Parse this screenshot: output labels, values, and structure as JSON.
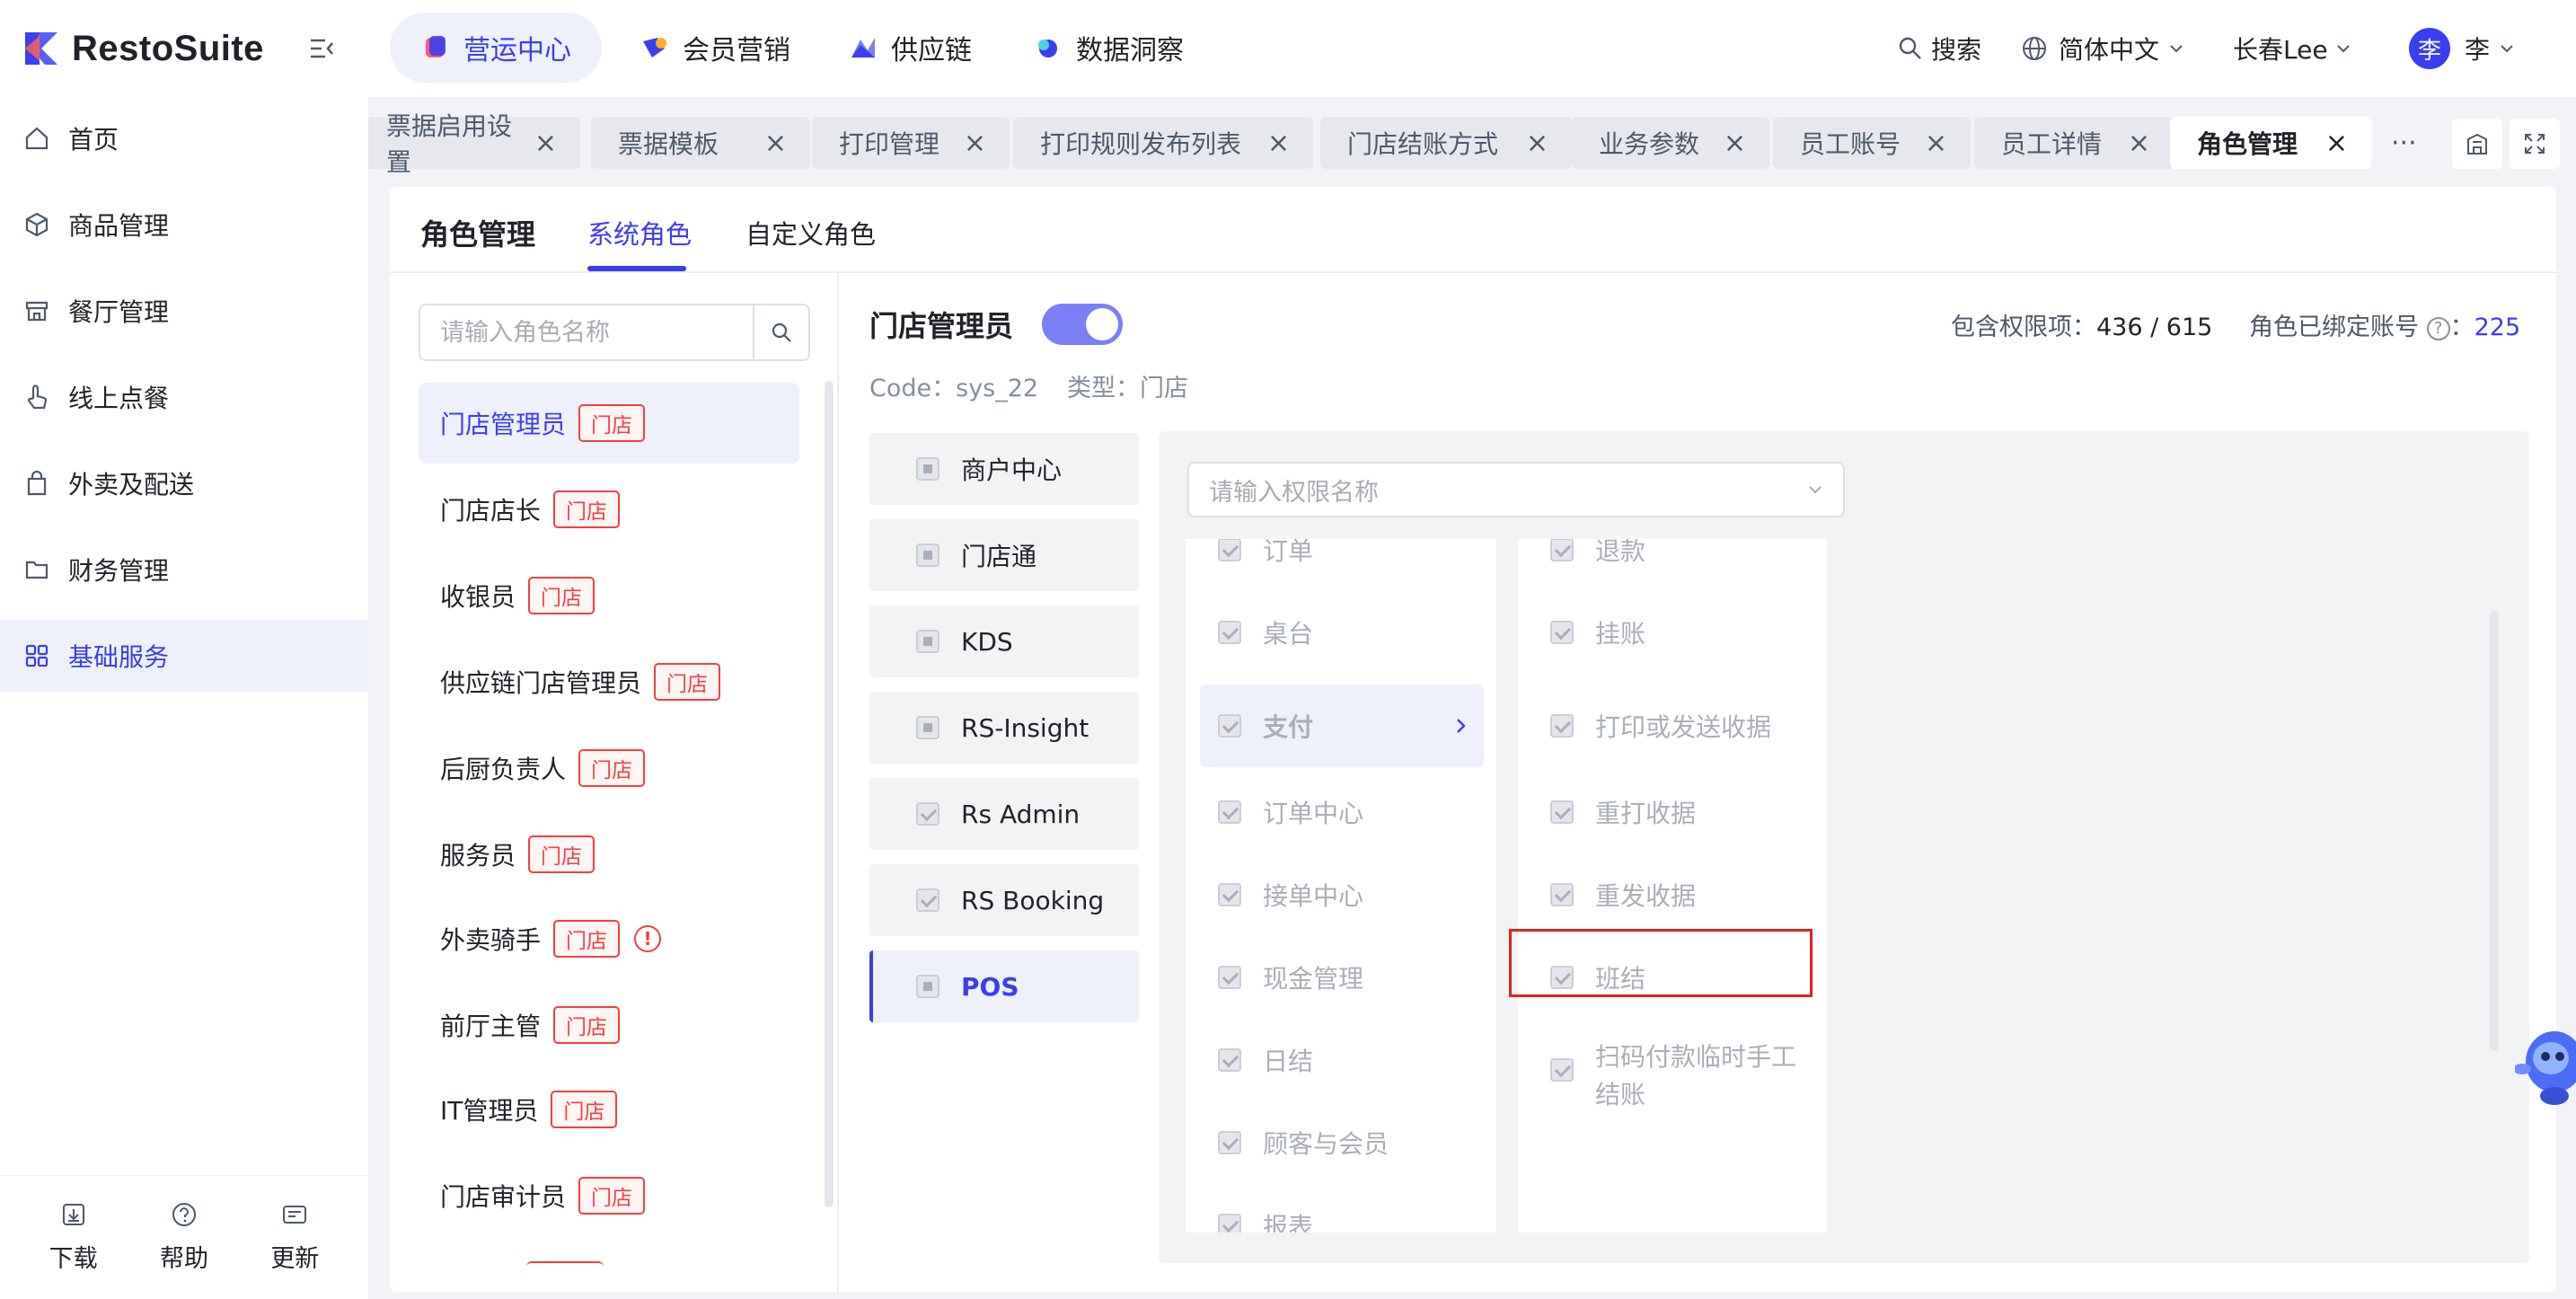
{
  "app": {
    "name": "RestoSuite"
  },
  "colors": {
    "accent": "#3a3ef0",
    "danger": "#f53f3f",
    "highlight_box": "#e5211f"
  },
  "sidebar": {
    "items": [
      {
        "label": "首页",
        "icon": "home-icon"
      },
      {
        "label": "商品管理",
        "icon": "box-icon"
      },
      {
        "label": "餐厅管理",
        "icon": "store-icon"
      },
      {
        "label": "线上点餐",
        "icon": "tap-icon"
      },
      {
        "label": "外卖及配送",
        "icon": "bag-icon"
      },
      {
        "label": "财务管理",
        "icon": "folder-icon"
      },
      {
        "label": "基础服务",
        "icon": "grid-icon",
        "active": true
      }
    ],
    "bottom": [
      {
        "label": "下载",
        "icon": "download-icon"
      },
      {
        "label": "帮助",
        "icon": "help-icon"
      },
      {
        "label": "更新",
        "icon": "update-icon"
      }
    ]
  },
  "topnav": {
    "items": [
      {
        "label": "营运中心",
        "active": true
      },
      {
        "label": "会员营销"
      },
      {
        "label": "供应链"
      },
      {
        "label": "数据洞察"
      }
    ],
    "search": "搜索",
    "language": "简体中文",
    "store": "长春Lee",
    "user": {
      "avatar_char": "李",
      "name": "李"
    }
  },
  "tabs": [
    {
      "label": "票据启用设置"
    },
    {
      "label": "票据模板"
    },
    {
      "label": "打印管理"
    },
    {
      "label": "打印规则发布列表"
    },
    {
      "label": "门店结账方式"
    },
    {
      "label": "业务参数"
    },
    {
      "label": "员工账号"
    },
    {
      "label": "员工详情"
    },
    {
      "label": "角色管理",
      "active": true
    }
  ],
  "tabs_more": "···",
  "page": {
    "title": "角色管理",
    "tabs": [
      {
        "label": "系统角色",
        "active": true
      },
      {
        "label": "自定义角色"
      }
    ]
  },
  "roles": {
    "search_placeholder": "请输入角色名称",
    "items": [
      {
        "name": "门店管理员",
        "tag": "门店",
        "active": true
      },
      {
        "name": "门店店长",
        "tag": "门店"
      },
      {
        "name": "收银员",
        "tag": "门店"
      },
      {
        "name": "供应链门店管理员",
        "tag": "门店"
      },
      {
        "name": "后厨负责人",
        "tag": "门店"
      },
      {
        "name": "服务员",
        "tag": "门店"
      },
      {
        "name": "外卖骑手",
        "tag": "门店",
        "warning": "!"
      },
      {
        "name": "前厅主管",
        "tag": "门店"
      },
      {
        "name": "IT管理员",
        "tag": "门店"
      },
      {
        "name": "门店审计员",
        "tag": "门店"
      }
    ]
  },
  "detail": {
    "role_name": "门店管理员",
    "enabled": true,
    "code": "Code：sys_22",
    "type": "类型：门店",
    "perm_label": "包含权限项：",
    "perm_count": "436 / 615",
    "bound_label": "角色已绑定账号",
    "bound_sep": "：",
    "bound_count": "225",
    "help_glyph": "?",
    "modules": [
      {
        "label": "商户中心",
        "state": "partial"
      },
      {
        "label": "门店通",
        "state": "partial"
      },
      {
        "label": "KDS",
        "state": "partial"
      },
      {
        "label": "RS-Insight",
        "state": "partial"
      },
      {
        "label": "Rs Admin",
        "state": "checked"
      },
      {
        "label": "RS Booking",
        "state": "checked"
      },
      {
        "label": "POS",
        "state": "partial",
        "active": true
      }
    ],
    "perm_search_placeholder": "请输入权限名称",
    "col1": [
      {
        "label": "订单"
      },
      {
        "label": "桌台"
      },
      {
        "label": "支付",
        "selected": true
      },
      {
        "label": "订单中心"
      },
      {
        "label": "接单中心"
      },
      {
        "label": "现金管理"
      },
      {
        "label": "日结"
      },
      {
        "label": "顾客与会员"
      },
      {
        "label": "报表"
      }
    ],
    "col2": [
      {
        "label": "退款"
      },
      {
        "label": "挂账"
      },
      {
        "label": "打印或发送收据"
      },
      {
        "label": "重打收据"
      },
      {
        "label": "重发收据"
      },
      {
        "label": "班结",
        "highlighted": true
      },
      {
        "label": "扫码付款临时手工结账"
      }
    ]
  }
}
